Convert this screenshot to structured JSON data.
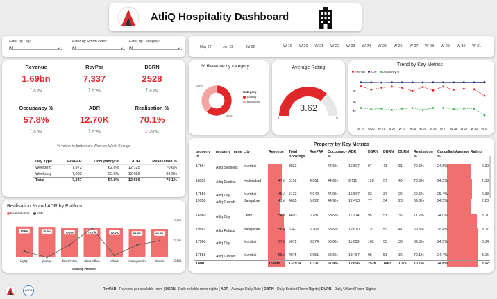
{
  "header": {
    "title": "AtliQ Hospitality Dashboard"
  },
  "filters": [
    {
      "label": "Filter by City",
      "value": "All"
    },
    {
      "label": "Filter by Room class",
      "value": "All"
    },
    {
      "label": "Filter by Category",
      "value": "All"
    }
  ],
  "date_slicer": {
    "months": [
      "May 22",
      "Jun 22",
      "Jul 22"
    ],
    "weeks": [
      "W 19",
      "W 20",
      "W 21",
      "W 22",
      "W 23",
      "W 24",
      "W 25",
      "W 26",
      "W 27",
      "W 28",
      "W 29",
      "W 30",
      "W 31"
    ]
  },
  "kpis": [
    {
      "title": "Revenue",
      "value": "1.69bn",
      "change": "0.2%",
      "direction": "up"
    },
    {
      "title": "RevPar",
      "value": "7,337",
      "change": "0.2%",
      "direction": "up"
    },
    {
      "title": "DSRN",
      "value": "2528",
      "change": "0.2%",
      "direction": "up"
    },
    {
      "title": "Occupancy %",
      "value": "57.8%",
      "change": "0.0%",
      "direction": "up"
    },
    {
      "title": "ADR",
      "value": "12.70K",
      "change": "0.2%",
      "direction": "up"
    },
    {
      "title": "Realisation %",
      "value": "70.1%",
      "change": "-0.0%",
      "direction": "down"
    }
  ],
  "kpi_note": "% values to bottom are Week on Week Change",
  "day_type_table": {
    "headers": [
      "Day Type",
      "RevPAR",
      "Occupancy %",
      "ADR",
      "Realisation %"
    ],
    "rows": [
      [
        "Weekend",
        "7,972",
        "62.6%",
        "12,725",
        "70.6%"
      ],
      [
        "Weekday",
        "7,083",
        "55.8%",
        "12,682",
        "69.9%"
      ]
    ],
    "total": [
      "Total",
      "7,337",
      "57.8%",
      "12,696",
      "70.1%"
    ]
  },
  "platform_chart": {
    "title": "Realisation % and ADR by Platform",
    "legend": [
      "Realisation %",
      "ADR"
    ],
    "xlabel": "Booking Platform",
    "right_ticks": [
      "12,800",
      "12,700",
      "12,600"
    ]
  },
  "category_chart": {
    "title": "% Revenue by category",
    "legend_title": "Category",
    "legend": [
      "Luxury",
      "Business"
    ],
    "label_outer": "38%",
    "label_inner": "62%"
  },
  "gauge": {
    "title": "Average Rating",
    "value": "3.62",
    "min": "0",
    "max": "5"
  },
  "trend_chart": {
    "title": "Trend by Key Metrics",
    "legend": [
      "RevPAR",
      "ADR",
      "Occupancy %"
    ],
    "y_ticks": [
      "6K",
      "5K",
      "4K"
    ],
    "x_ticks": [
      "W 19",
      "W 20",
      "W 21",
      "W 22",
      "W 23",
      "W 24",
      "W 25",
      "W 26",
      "W 27",
      "W 28",
      "W 29",
      "W 30",
      "W 31"
    ]
  },
  "property_table": {
    "title": "Property by Key Metrics",
    "headers": [
      "property id",
      "property_name",
      "city",
      "Revenue",
      "Total Bookings",
      "RevPAR",
      "Occupancy %",
      "ADR",
      "DSRN",
      "DBRN",
      "DURN",
      "Realisation %",
      "Cancellation %",
      "Average Rating"
    ],
    "rows": [
      [
        "17564",
        "Atliq Seasons",
        "Mumbai",
        "",
        "3033",
        "",
        "44.6%",
        "16,597",
        "97",
        "43",
        "31",
        "70.6%",
        "24.8%",
        "2.30"
      ],
      [
        "18559",
        "Atliq Exotica",
        "Hyderabad",
        "47M",
        "5192",
        "4,061",
        "44.6%",
        "9,111",
        "128",
        "57",
        "40",
        "70.6%",
        "24.3%",
        "2.33"
      ],
      [
        "17559",
        "Atliq City",
        "Mumbai",
        "45M",
        "5132",
        "4,042",
        "44.9%",
        "15,567",
        "83",
        "37",
        "26",
        "69.6%",
        "25.4%",
        "2.33"
      ],
      [
        "19558",
        "Atliq Grands",
        "Bangalore",
        "42M",
        "4635",
        "5,622",
        "44.9%",
        "12,493",
        "77",
        "34",
        "23",
        "69.6%",
        "24.5%",
        "2.28"
      ],
      [
        "16560",
        "Atliq City",
        "Delhi",
        "54M",
        "4693",
        "6,281",
        "53.6%",
        "11,714",
        "95",
        "51",
        "36",
        "71.2%",
        "24.0%",
        "3.01"
      ],
      [
        "19561",
        "Atliq Palace",
        "Bangalore",
        "56M",
        "5347",
        "6,768",
        "53.6%",
        "12,670",
        "110",
        "59",
        "41",
        "69.5%",
        "25.4%",
        "3.07"
      ],
      [
        "17560",
        "Atliq City",
        "Mumbai",
        "57M",
        "5072",
        "6,874",
        "53.6%",
        "11,693",
        "102",
        "55",
        "38",
        "69.5%",
        "24.5%",
        "3.04"
      ],
      [
        "17558",
        "Atliq Grands",
        "Mumbai",
        "55M",
        "4975",
        "6,951",
        "53.6%",
        "13,487",
        "95",
        "51",
        "36",
        "70.1%",
        "24.4%",
        "3.05"
      ]
    ],
    "total": [
      "Total",
      "",
      "",
      "1688M",
      "132939",
      "7,337",
      "57.8%",
      "12,696",
      "2528",
      "1461",
      "1025",
      "70.1%",
      "24.8%",
      "3.62"
    ]
  },
  "footer": {
    "legend_html": [
      {
        "key": "RevPAR",
        "desc": " - Revenue per available room | "
      },
      {
        "key": "DSRN",
        "desc": " - Daily sellable room nights | "
      },
      {
        "key": "ADR",
        "desc": " - Average Daily Rate | "
      },
      {
        "key": "DBRN",
        "desc": " - Daily Booked Room Nights | "
      },
      {
        "key": "DURN",
        "desc": " - Daily Utilized Room Nights"
      }
    ],
    "badge": "CODE"
  },
  "colors": {
    "accent": "#e0282a",
    "bar": "#f07070",
    "green": "#3fb34f",
    "blue": "#1f2e8a"
  },
  "chart_data": [
    {
      "type": "bar",
      "title": "Realisation % and ADR by Platform",
      "categories": [
        "logtrip",
        "journey",
        "direct online",
        "direct offline",
        "others",
        "makeyourtrip",
        "tripster"
      ],
      "series": [
        {
          "name": "Realisation %",
          "values": [
            70.6,
            70.5,
            70.2,
            70.2,
            70.1,
            69.8,
            69.8
          ]
        },
        {
          "name": "ADR",
          "values": [
            12650,
            12620,
            12680,
            12760,
            12630,
            12680,
            12700
          ]
        }
      ],
      "xlabel": "Booking Platform",
      "y2lim": [
        12600,
        12800
      ]
    },
    {
      "type": "pie",
      "title": "% Revenue by category",
      "categories": [
        "Luxury",
        "Business"
      ],
      "values": [
        62,
        38
      ]
    },
    {
      "type": "line",
      "title": "Trend by Key Metrics",
      "x": [
        "W 19",
        "W 20",
        "W 21",
        "W 22",
        "W 23",
        "W 24",
        "W 25",
        "W 26",
        "W 27",
        "W 28",
        "W 29",
        "W 30",
        "W 31"
      ],
      "series": [
        {
          "name": "RevPAR",
          "values": [
            6300,
            6050,
            6200,
            6280,
            6200,
            5950,
            6250,
            6000,
            6280,
            6050,
            6120,
            6080,
            5600
          ]
        },
        {
          "name": "ADR",
          "values": [
            6600,
            6600,
            6580,
            6600,
            6600,
            6600,
            6590,
            6600,
            6600,
            6600,
            6610,
            6600,
            6620
          ]
        },
        {
          "name": "Occupancy %",
          "values": [
            4700,
            4600,
            4650,
            4550,
            4650,
            4700,
            4550,
            4700,
            4700,
            4600,
            4650,
            4650,
            4150
          ]
        }
      ]
    }
  ]
}
